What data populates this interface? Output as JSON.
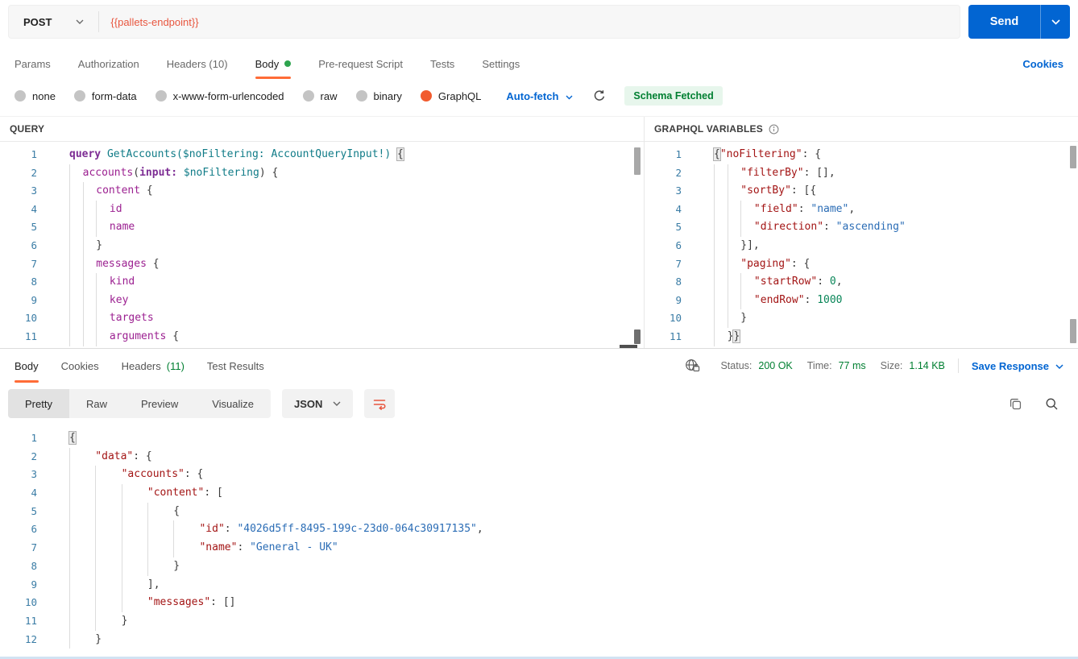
{
  "colors": {
    "accent": "#ff6c37",
    "radio-sel": "#f15b2e",
    "url": "#e8563f",
    "blue": "#0265d2",
    "green": "#007f31",
    "dot": "#2da44e",
    "badge-bg": "#e7f6ec",
    "ln": "#3a7ca5",
    "kw": "#7d2d94",
    "fn": "#0f7b87",
    "fld": "#9c2191",
    "key": "#a31515",
    "str": "#2a6cb5",
    "num": "#098658"
  },
  "icons": {
    "chevron-down-icon": "v",
    "refresh-icon": "↻",
    "info-icon": "ⓘ",
    "globe-lock-icon": "globe+lock",
    "copy-icon": "double-square",
    "search-icon": "magnifier",
    "wrap-text-icon": "orange-wrap-lines",
    "body-modified-dot": "green-dot"
  },
  "request_bar": {
    "method": "POST",
    "url": "{{pallets-endpoint}}",
    "send_label": "Send"
  },
  "request_tabs": {
    "items": [
      "Params",
      "Authorization",
      "Headers (10)",
      "Body",
      "Pre-request Script",
      "Tests",
      "Settings"
    ],
    "active": "Body",
    "cookies_label": "Cookies"
  },
  "body_types": {
    "options": [
      "none",
      "form-data",
      "x-www-form-urlencoded",
      "raw",
      "binary",
      "GraphQL"
    ],
    "selected": "GraphQL",
    "autofetch_label": "Auto-fetch",
    "schema_status": "Schema Fetched"
  },
  "panels": {
    "query_title": "QUERY",
    "variables_title": "GRAPHQL VARIABLES"
  },
  "response": {
    "tabs": [
      {
        "label": "Body"
      },
      {
        "label": "Cookies"
      },
      {
        "label": "Headers",
        "count": "(11)"
      },
      {
        "label": "Test Results"
      }
    ],
    "active_tab": "Body",
    "status_label": "Status:",
    "status_value": "200 OK",
    "time_label": "Time:",
    "time_value": "77 ms",
    "size_label": "Size:",
    "size_value": "1.14 KB",
    "save_label": "Save Response",
    "view_tabs": [
      "Pretty",
      "Raw",
      "Preview",
      "Visualize"
    ],
    "active_view": "Pretty",
    "format_label": "JSON"
  },
  "editors": {
    "query": {
      "unit": 2,
      "lines": [
        {
          "n": 1,
          "lvl": 0,
          "t": [
            [
              "kw",
              "query"
            ],
            [
              "pl",
              " "
            ],
            [
              "fn",
              "GetAccounts($noFiltering: AccountQueryInput!)"
            ],
            [
              "pl",
              " "
            ],
            [
              "gh",
              "{"
            ]
          ]
        },
        {
          "n": 2,
          "lvl": 1,
          "t": [
            [
              "fld",
              "accounts"
            ],
            [
              "pl",
              "("
            ],
            [
              "kw",
              "input:"
            ],
            [
              "pl",
              " "
            ],
            [
              "fn",
              "$noFiltering"
            ],
            [
              "pl",
              ") {"
            ]
          ]
        },
        {
          "n": 3,
          "lvl": 2,
          "t": [
            [
              "fld",
              "content"
            ],
            [
              "pl",
              " {"
            ]
          ]
        },
        {
          "n": 4,
          "lvl": 3,
          "t": [
            [
              "fld",
              "id"
            ]
          ]
        },
        {
          "n": 5,
          "lvl": 3,
          "t": [
            [
              "fld",
              "name"
            ]
          ]
        },
        {
          "n": 6,
          "lvl": 2,
          "t": [
            [
              "pl",
              "}"
            ]
          ]
        },
        {
          "n": 7,
          "lvl": 2,
          "t": [
            [
              "fld",
              "messages"
            ],
            [
              "pl",
              " {"
            ]
          ]
        },
        {
          "n": 8,
          "lvl": 3,
          "t": [
            [
              "fld",
              "kind"
            ]
          ]
        },
        {
          "n": 9,
          "lvl": 3,
          "t": [
            [
              "fld",
              "key"
            ]
          ]
        },
        {
          "n": 10,
          "lvl": 3,
          "t": [
            [
              "fld",
              "targets"
            ]
          ]
        },
        {
          "n": 11,
          "lvl": 3,
          "t": [
            [
              "fld",
              "arguments"
            ],
            [
              "pl",
              " {"
            ]
          ]
        }
      ]
    },
    "variables": {
      "unit": 2,
      "lines": [
        {
          "n": 1,
          "lvl": 0,
          "t": [
            [
              "gh",
              "{"
            ],
            [
              "key",
              "\"noFiltering\""
            ],
            [
              "pl",
              ": {"
            ]
          ]
        },
        {
          "n": 2,
          "lvl": 2,
          "t": [
            [
              "key",
              "\"filterBy\""
            ],
            [
              "pl",
              ": [],"
            ]
          ]
        },
        {
          "n": 3,
          "lvl": 2,
          "t": [
            [
              "key",
              "\"sortBy\""
            ],
            [
              "pl",
              ": [{"
            ]
          ]
        },
        {
          "n": 4,
          "lvl": 3,
          "t": [
            [
              "key",
              "\"field\""
            ],
            [
              "pl",
              ": "
            ],
            [
              "str",
              "\"name\""
            ],
            [
              "pl",
              ","
            ]
          ]
        },
        {
          "n": 5,
          "lvl": 3,
          "t": [
            [
              "key",
              "\"direction\""
            ],
            [
              "pl",
              ": "
            ],
            [
              "str",
              "\"ascending\""
            ]
          ]
        },
        {
          "n": 6,
          "lvl": 2,
          "t": [
            [
              "pl",
              "}],"
            ]
          ]
        },
        {
          "n": 7,
          "lvl": 2,
          "t": [
            [
              "key",
              "\"paging\""
            ],
            [
              "pl",
              ": {"
            ]
          ]
        },
        {
          "n": 8,
          "lvl": 3,
          "t": [
            [
              "key",
              "\"startRow\""
            ],
            [
              "pl",
              ": "
            ],
            [
              "num",
              "0"
            ],
            [
              "pl",
              ","
            ]
          ]
        },
        {
          "n": 9,
          "lvl": 3,
          "t": [
            [
              "key",
              "\"endRow\""
            ],
            [
              "pl",
              ": "
            ],
            [
              "num",
              "1000"
            ]
          ]
        },
        {
          "n": 10,
          "lvl": 2,
          "t": [
            [
              "pl",
              "}"
            ]
          ]
        },
        {
          "n": 11,
          "lvl": 1,
          "t": [
            [
              "pl",
              "}"
            ],
            [
              "gh",
              "}"
            ]
          ]
        }
      ]
    },
    "response": {
      "unit": 4,
      "lines": [
        {
          "n": 1,
          "lvl": 0,
          "t": [
            [
              "gh",
              "{"
            ]
          ]
        },
        {
          "n": 2,
          "lvl": 1,
          "t": [
            [
              "key",
              "\"data\""
            ],
            [
              "pl",
              ": {"
            ]
          ]
        },
        {
          "n": 3,
          "lvl": 2,
          "t": [
            [
              "key",
              "\"accounts\""
            ],
            [
              "pl",
              ": {"
            ]
          ]
        },
        {
          "n": 4,
          "lvl": 3,
          "t": [
            [
              "key",
              "\"content\""
            ],
            [
              "pl",
              ": ["
            ]
          ]
        },
        {
          "n": 5,
          "lvl": 4,
          "t": [
            [
              "pl",
              "{"
            ]
          ]
        },
        {
          "n": 6,
          "lvl": 5,
          "t": [
            [
              "key",
              "\"id\""
            ],
            [
              "pl",
              ": "
            ],
            [
              "str",
              "\"4026d5ff-8495-199c-23d0-064c30917135\""
            ],
            [
              "pl",
              ","
            ]
          ]
        },
        {
          "n": 7,
          "lvl": 5,
          "t": [
            [
              "key",
              "\"name\""
            ],
            [
              "pl",
              ": "
            ],
            [
              "str",
              "\"General - UK\""
            ]
          ]
        },
        {
          "n": 8,
          "lvl": 4,
          "t": [
            [
              "pl",
              "}"
            ]
          ]
        },
        {
          "n": 9,
          "lvl": 3,
          "t": [
            [
              "pl",
              "],"
            ]
          ]
        },
        {
          "n": 10,
          "lvl": 3,
          "t": [
            [
              "key",
              "\"messages\""
            ],
            [
              "pl",
              ": []"
            ]
          ]
        },
        {
          "n": 11,
          "lvl": 2,
          "t": [
            [
              "pl",
              "}"
            ]
          ]
        },
        {
          "n": 12,
          "lvl": 1,
          "t": [
            [
              "pl",
              "}"
            ]
          ]
        }
      ]
    }
  }
}
